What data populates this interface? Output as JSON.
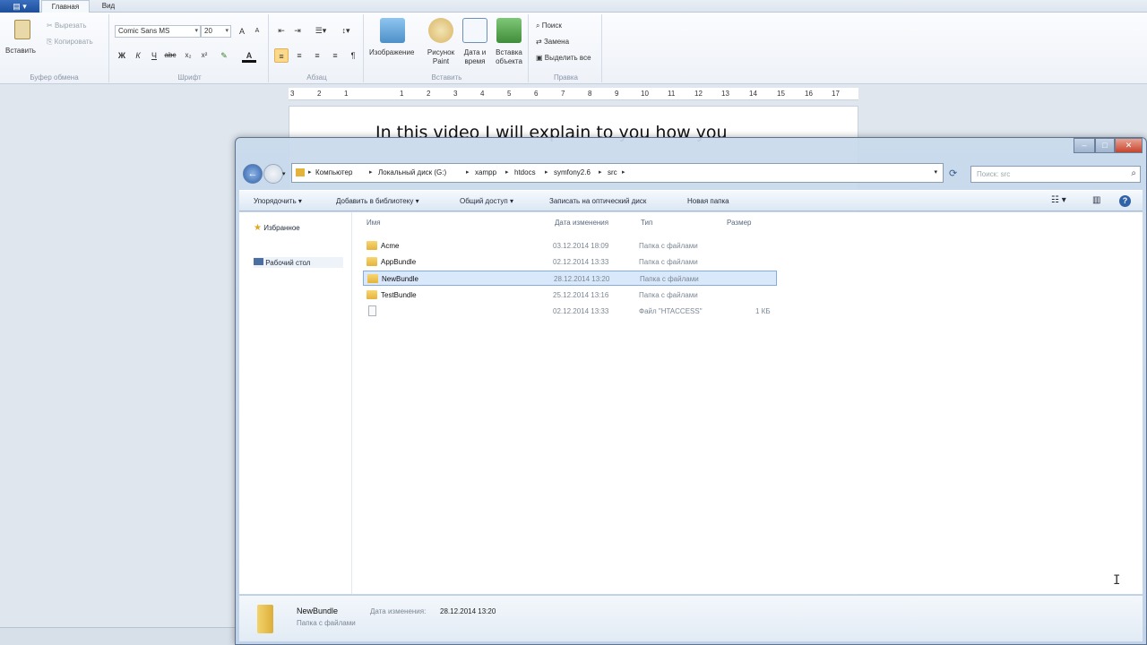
{
  "wordpad": {
    "tabs": [
      "Главная",
      "Вид"
    ],
    "clipboard": {
      "paste": "Вставить",
      "cut": "Вырезать",
      "copy": "Копировать",
      "label": "Буфер обмена"
    },
    "font": {
      "family": "Comic Sans MS",
      "size": "20",
      "label": "Шрифт",
      "bold": "Ж",
      "italic": "К",
      "underline": "Ч",
      "strike": "abc"
    },
    "paragraph": {
      "label": "Абзац"
    },
    "insert": {
      "image": "Изображение",
      "paint": "Рисунок Paint",
      "datetime": "Дата и время",
      "object": "Вставка объекта",
      "label": "Вставить"
    },
    "editing": {
      "find": "Поиск",
      "replace": "Замена",
      "select_all": "Выделить все",
      "label": "Правка"
    },
    "ruler": [
      "3",
      "2",
      "1",
      "1",
      "2",
      "3",
      "4",
      "5",
      "6",
      "7",
      "8",
      "9",
      "10",
      "11",
      "12",
      "13",
      "14",
      "15",
      "16",
      "17"
    ],
    "doc_text": "In this video I will explain to you how you"
  },
  "explorer": {
    "breadcrumb": [
      "Компьютер",
      "Локальный диск (G:)",
      "xampp",
      "htdocs",
      "symfony2.6",
      "src"
    ],
    "search_placeholder": "Поиск: src",
    "commands": [
      "Упорядочить ▾",
      "Добавить в библиотеку ▾",
      "Общий доступ ▾",
      "Записать на оптический диск",
      "Новая папка"
    ],
    "nav": {
      "favorites": "Избранное",
      "desktop": "Рабочий стол"
    },
    "columns": {
      "name": "Имя",
      "date": "Дата изменения",
      "type": "Тип",
      "size": "Размер"
    },
    "files": [
      {
        "name": "Acme",
        "date": "03.12.2014 18:09",
        "type": "Папка с файлами",
        "size": ""
      },
      {
        "name": "AppBundle",
        "date": "02.12.2014 13:33",
        "type": "Папка с файлами",
        "size": ""
      },
      {
        "name": "NewBundle",
        "date": "28.12.2014 13:20",
        "type": "Папка с файлами",
        "size": ""
      },
      {
        "name": "TestBundle",
        "date": "25.12.2014 13:16",
        "type": "Папка с файлами",
        "size": ""
      },
      {
        "name": "",
        "date": "02.12.2014 13:33",
        "type": "Файл \"HTACCESS\"",
        "size": "1 КБ"
      }
    ],
    "details": {
      "name": "NewBundle",
      "modified_label": "Дата изменения:",
      "modified": "28.12.2014 13:20",
      "type": "Папка с файлами"
    }
  }
}
